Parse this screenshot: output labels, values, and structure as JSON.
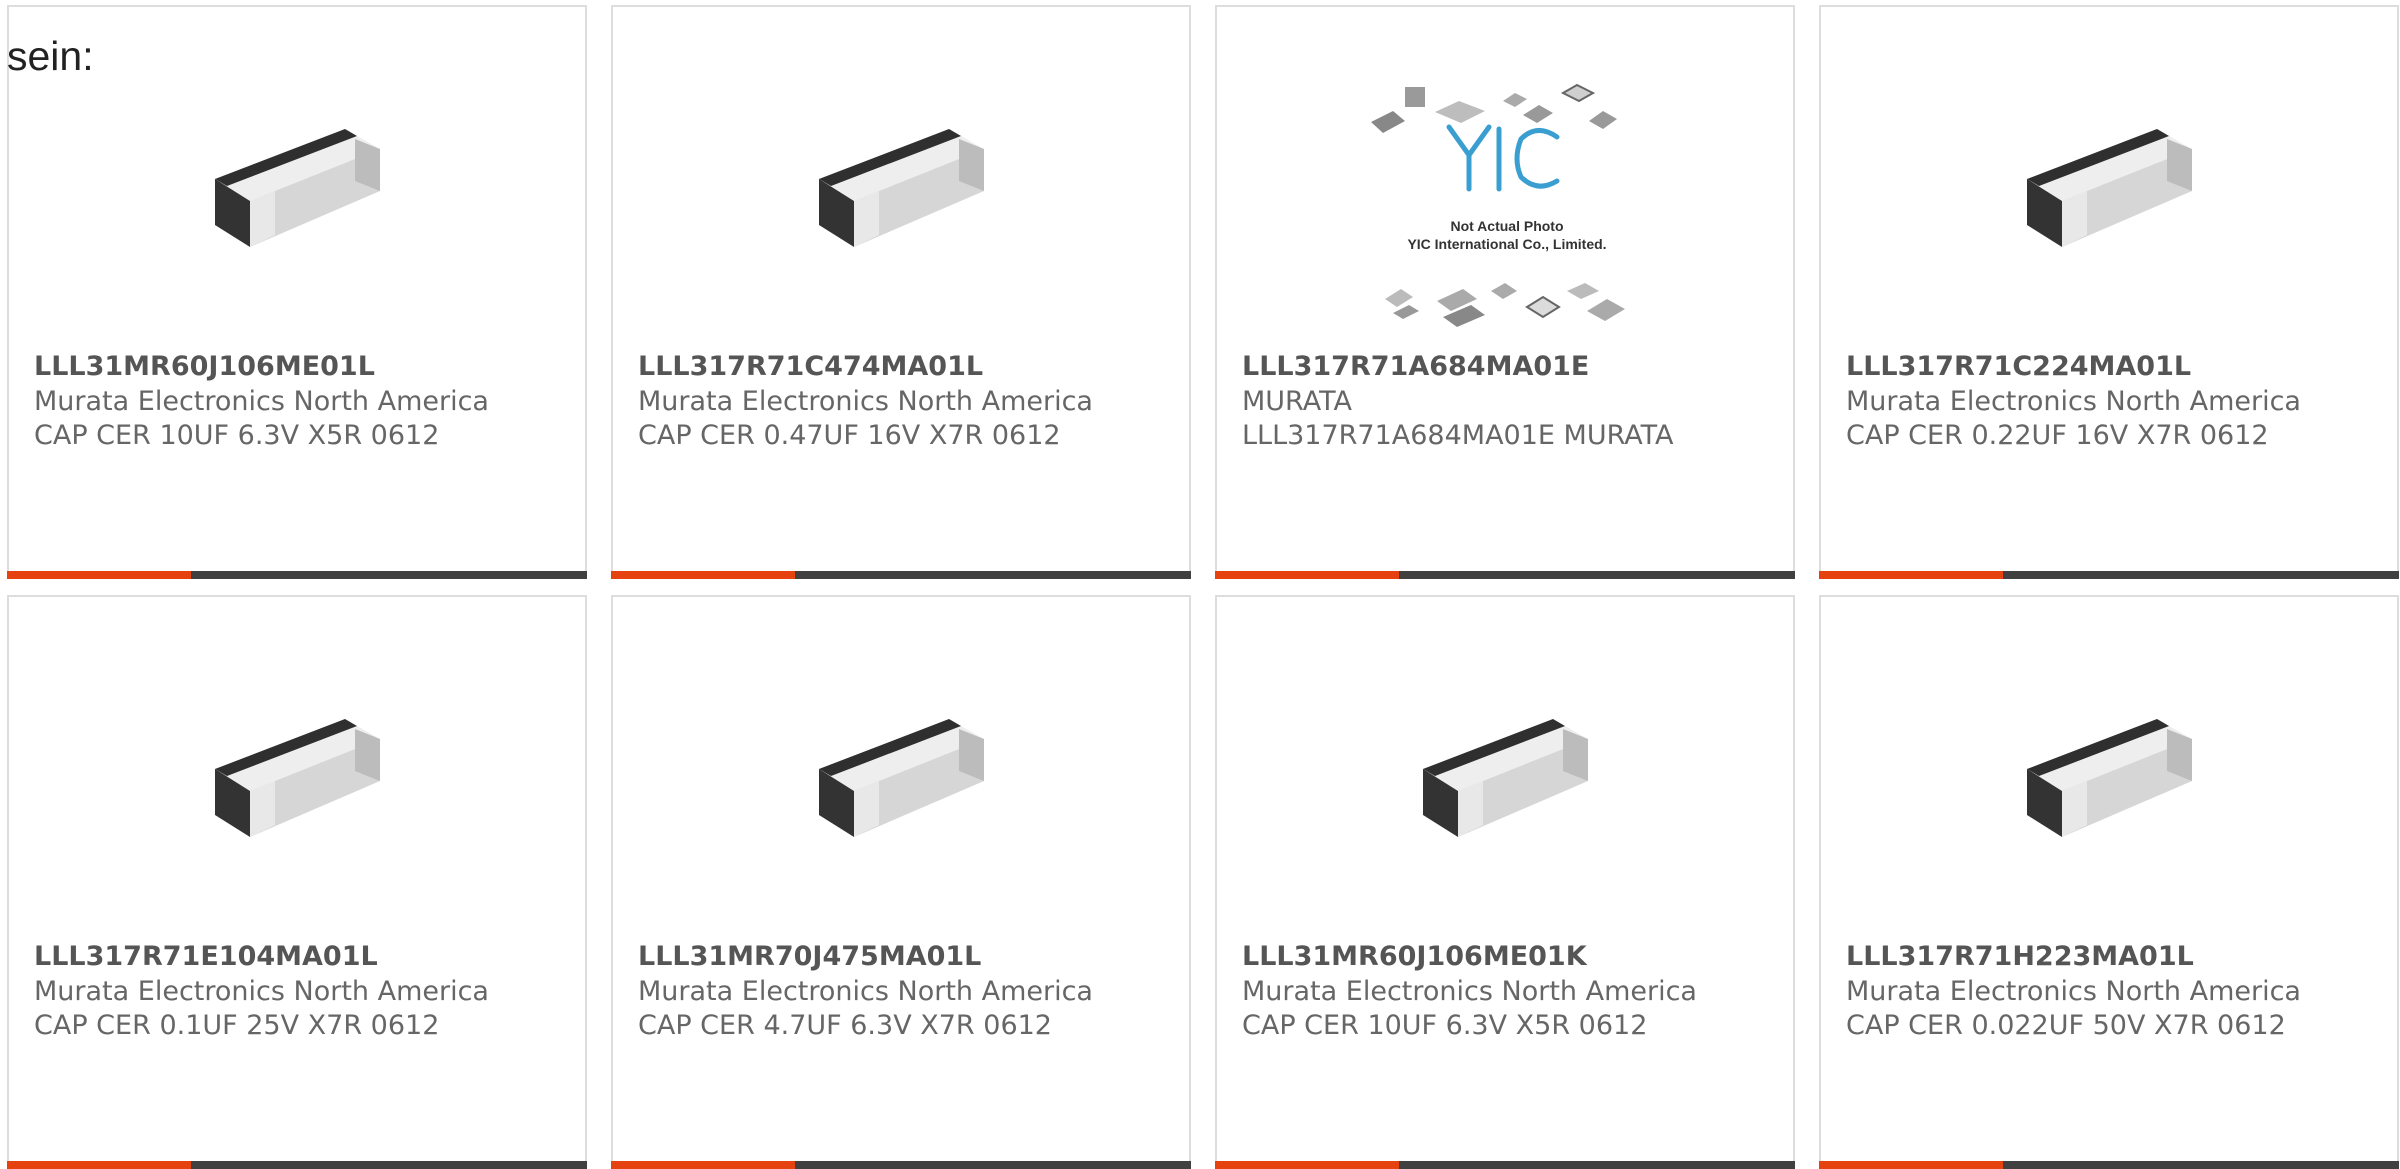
{
  "lead_text": "sein:",
  "colors": {
    "accent": "#e5420f",
    "bar": "#404040",
    "border": "#dddddd"
  },
  "placeholder": {
    "line1": "Not Actual Photo",
    "line2": "YIC International Co., Limited.",
    "logo": "YIC"
  },
  "products": [
    {
      "part": "LLL31MR60J106ME01L",
      "manufacturer": "Murata Electronics North America",
      "description": "CAP CER 10UF 6.3V X5R 0612",
      "image": "chip-capacitor"
    },
    {
      "part": "LLL317R71C474MA01L",
      "manufacturer": "Murata Electronics North America",
      "description": "CAP CER 0.47UF 16V X7R 0612",
      "image": "chip-capacitor"
    },
    {
      "part": "LLL317R71A684MA01E",
      "manufacturer": "MURATA",
      "description": "LLL317R71A684MA01E MURATA",
      "image": "not-actual-photo"
    },
    {
      "part": "LLL317R71C224MA01L",
      "manufacturer": "Murata Electronics North America",
      "description": "CAP CER 0.22UF 16V X7R 0612",
      "image": "chip-capacitor"
    },
    {
      "part": "LLL317R71E104MA01L",
      "manufacturer": "Murata Electronics North America",
      "description": "CAP CER 0.1UF 25V X7R 0612",
      "image": "chip-capacitor"
    },
    {
      "part": "LLL31MR70J475MA01L",
      "manufacturer": "Murata Electronics North America",
      "description": "CAP CER 4.7UF 6.3V X7R 0612",
      "image": "chip-capacitor"
    },
    {
      "part": "LLL31MR60J106ME01K",
      "manufacturer": "Murata Electronics North America",
      "description": "CAP CER 10UF 6.3V X5R 0612",
      "image": "chip-capacitor"
    },
    {
      "part": "LLL317R71H223MA01L",
      "manufacturer": "Murata Electronics North America",
      "description": "CAP CER 0.022UF 50V X7R 0612",
      "image": "chip-capacitor"
    }
  ]
}
